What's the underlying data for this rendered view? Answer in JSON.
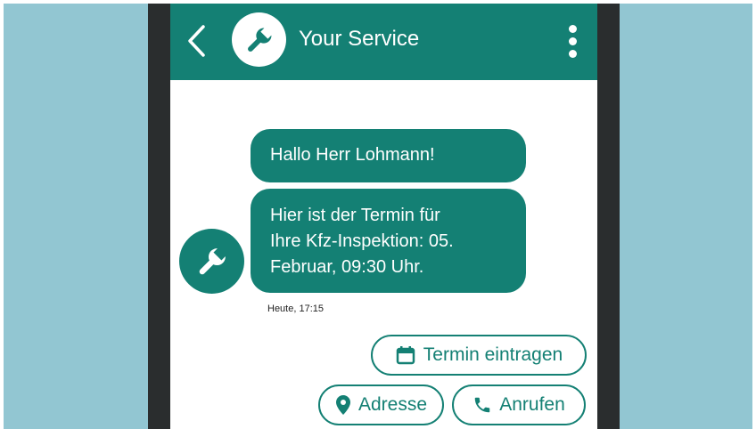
{
  "colors": {
    "accent": "#148074",
    "background": "#92c6d2",
    "device": "#2a2d2e"
  },
  "header": {
    "title": "Your Service",
    "back_icon": "chevron-left-icon",
    "avatar_icon": "wrench-icon",
    "menu_icon": "more-vertical-icon"
  },
  "messages": [
    {
      "text": "Hallo Herr Lohmann!"
    },
    {
      "text": "Hier ist der Termin für\nIhre Kfz-Inspektion: 05.\nFebruar, 09:30 Uhr."
    }
  ],
  "message_avatar_icon": "wrench-icon",
  "timestamp": "Heute, 17:15",
  "actions": {
    "termin": {
      "label": "Termin eintragen",
      "icon": "calendar-icon"
    },
    "adresse": {
      "label": "Adresse",
      "icon": "map-pin-icon"
    },
    "anrufen": {
      "label": "Anrufen",
      "icon": "phone-icon"
    }
  }
}
